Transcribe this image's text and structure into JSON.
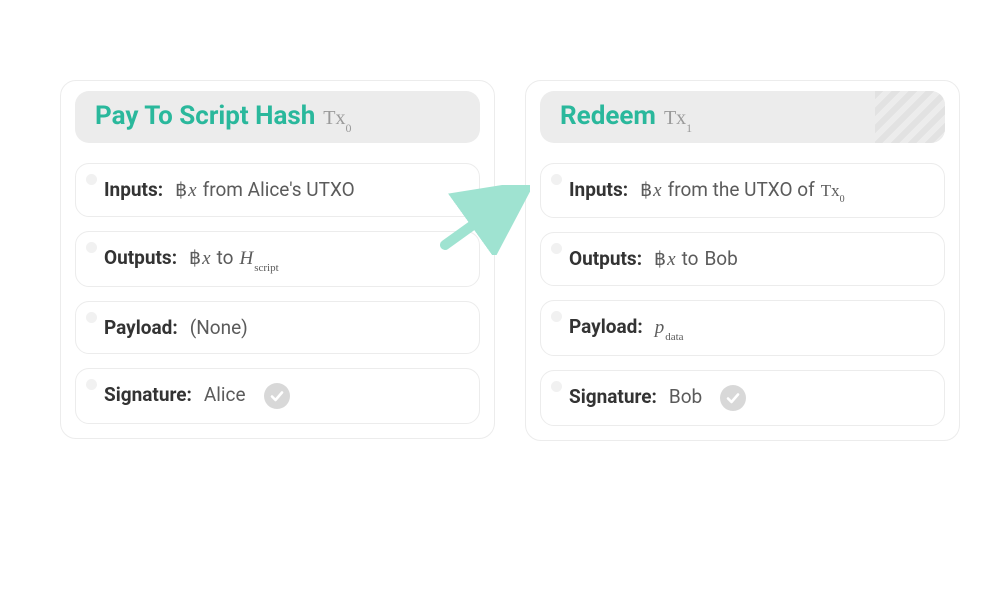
{
  "left": {
    "title": "Pay To Script Hash",
    "tx_label_base": "Tx",
    "tx_label_sub": "0",
    "inputs": {
      "label": "Inputs:",
      "amount_sym": "฿",
      "amount_var": "x",
      "text_after": "from Alice's UTXO"
    },
    "outputs": {
      "label": "Outputs:",
      "amount_sym": "฿",
      "amount_var": "x",
      "to": "to",
      "dest_base": "H",
      "dest_sub": "script"
    },
    "payload": {
      "label": "Payload:",
      "value": "(None)"
    },
    "signature": {
      "label": "Signature:",
      "value": "Alice"
    }
  },
  "right": {
    "title": "Redeem",
    "tx_label_base": "Tx",
    "tx_label_sub": "1",
    "inputs": {
      "label": "Inputs:",
      "amount_sym": "฿",
      "amount_var": "x",
      "text_after": "from the UTXO of",
      "ref_base": "Tx",
      "ref_sub": "0"
    },
    "outputs": {
      "label": "Outputs:",
      "amount_sym": "฿",
      "amount_var": "x",
      "to": "to",
      "dest_text": "Bob"
    },
    "payload": {
      "label": "Payload:",
      "value_base": "p",
      "value_sub": "data"
    },
    "signature": {
      "label": "Signature:",
      "value": "Bob"
    }
  }
}
